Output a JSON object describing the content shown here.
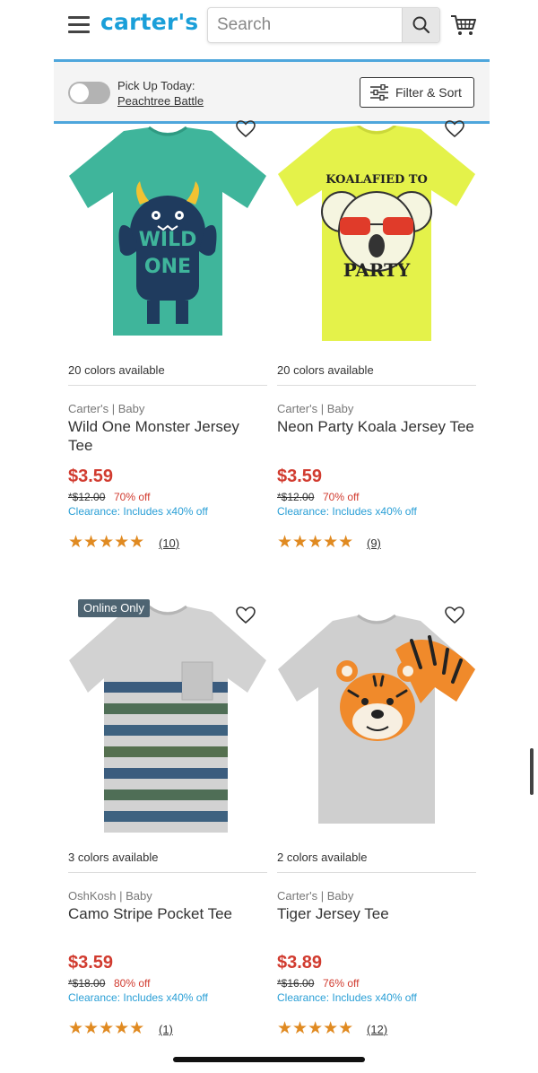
{
  "header": {
    "logo": "carter's",
    "search_placeholder": "Search"
  },
  "pickup": {
    "title": "Pick Up Today:",
    "store": "Peachtree Battle",
    "filter_label": "Filter & Sort"
  },
  "products": [
    {
      "colors": "20 colors available",
      "brand": "Carter's | Baby",
      "name": "Wild One Monster Jersey Tee",
      "price": "$3.59",
      "was": "*$12.00",
      "off": "70% off",
      "promo": "Clearance: Includes x40% off",
      "stars": "★★★★★",
      "reviews": "(10)"
    },
    {
      "colors": "20 colors available",
      "brand": "Carter's | Baby",
      "name": "Neon Party Koala Jersey Tee",
      "price": "$3.59",
      "was": "*$12.00",
      "off": "70% off",
      "promo": "Clearance: Includes x40% off",
      "stars": "★★★★★",
      "reviews": "(9)",
      "graphic_text_top": "KOALAFIED TO",
      "graphic_text_bottom": "PARTY"
    },
    {
      "badge": "Online Only",
      "colors": "3 colors available",
      "brand": "OshKosh | Baby",
      "name": "Camo Stripe Pocket Tee",
      "price": "$3.59",
      "was": "*$18.00",
      "off": "80% off",
      "promo": "Clearance: Includes x40% off",
      "stars": "★★★★★",
      "reviews": "(1)"
    },
    {
      "colors": "2 colors available",
      "brand": "Carter's | Baby",
      "name": "Tiger Jersey Tee",
      "price": "$3.89",
      "was": "*$16.00",
      "off": "76% off",
      "promo": "Clearance: Includes x40% off",
      "stars": "★★★★★",
      "reviews": "(12)"
    }
  ],
  "icons": {
    "menu": "hamburger-icon",
    "search": "search-icon",
    "cart": "cart-icon",
    "filter": "filter-sliders-icon",
    "favorite": "heart-icon"
  },
  "colors": {
    "brand_blue": "#1a9fd9",
    "price_red": "#d13b2f",
    "promo_blue": "#2a9fd6",
    "star_orange": "#e08a21",
    "bar_border": "#4ea6dc"
  }
}
